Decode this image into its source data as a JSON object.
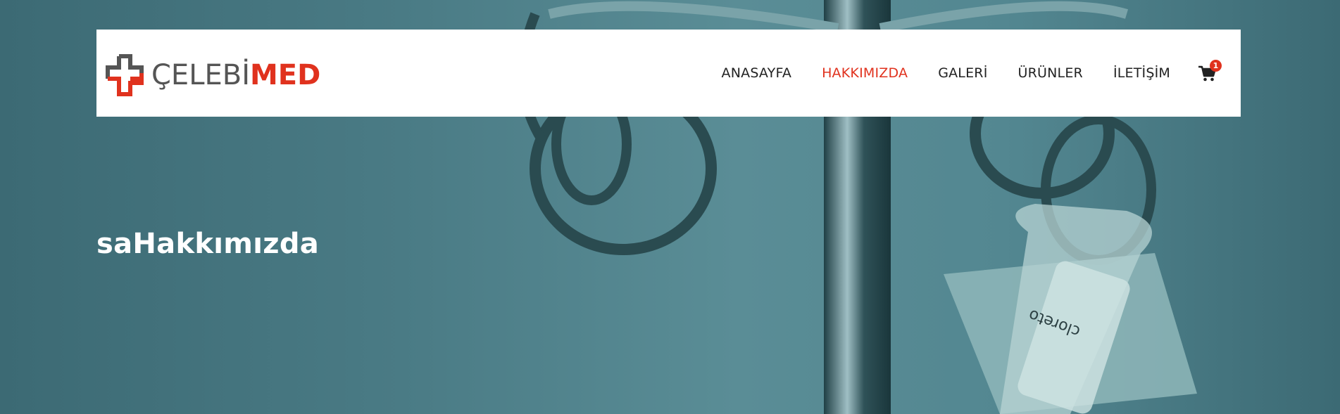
{
  "brand": {
    "name_part1": "ÇELEBİ",
    "name_part2": "MED",
    "logo_icon": "medical-cross-icon"
  },
  "nav": {
    "items": [
      {
        "label": "ANASAYFA",
        "active": false
      },
      {
        "label": "HAKKIMIZDA",
        "active": true
      },
      {
        "label": "GALERİ",
        "active": false
      },
      {
        "label": "ÜRÜNLER",
        "active": false
      },
      {
        "label": "İLETİŞİM",
        "active": false
      }
    ],
    "cart_icon": "shopping-cart-icon",
    "cart_count": "1"
  },
  "page": {
    "title": "saHakkımızda"
  },
  "colors": {
    "accent": "#e0321e",
    "nav_text": "#222222",
    "logo_gray": "#555555",
    "hero_tint": "#4a7b85"
  }
}
